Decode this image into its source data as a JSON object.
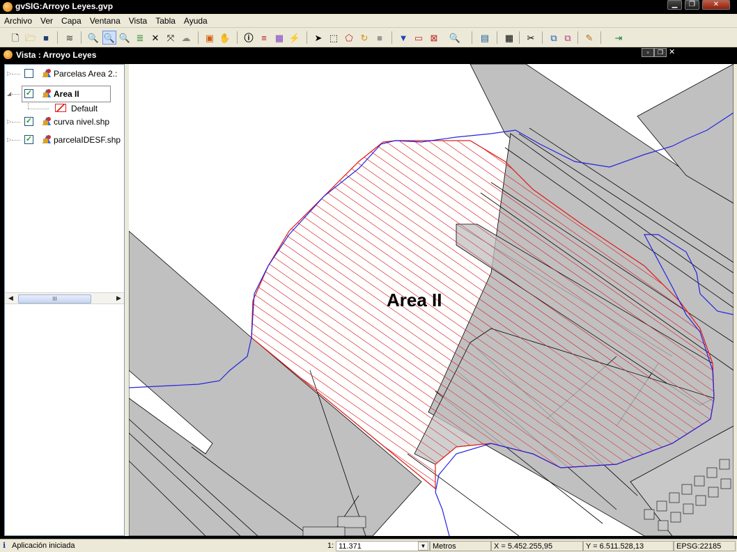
{
  "window": {
    "title": "gvSIG:Arroyo Leyes.gvp"
  },
  "menu": [
    "Archivo",
    "Ver",
    "Capa",
    "Ventana",
    "Vista",
    "Tabla",
    "Ayuda"
  ],
  "toolbar_icons": [
    "new-icon",
    "open-icon",
    "save-icon",
    "add-layer-icon",
    "zoom-all-icon",
    "zoom-in-icon",
    "zoom-out-icon",
    "layers-zoom-icon",
    "zoom-extent-icon",
    "full-extent-icon",
    "zoom-previous-icon",
    "locator-map-icon",
    "pan-icon",
    "info-icon",
    "measure-distance-icon",
    "measure-area-icon",
    "hyperlink-icon",
    "select-icon",
    "select-rect-icon",
    "select-polygon-icon",
    "invert-selection-icon",
    "clear-selection-icon",
    "filter-icon",
    "rect-select-icon",
    "select-layer-icon",
    "zoom-select-icon",
    "attribute-table-icon",
    "grid-icon",
    "tools-icon",
    "copy-icon",
    "paste-icon",
    "edit-icon",
    "export-icon"
  ],
  "view": {
    "title": "Vista : Arroyo Leyes"
  },
  "toc": {
    "layers": [
      {
        "label": "Parcelas Area 2.:",
        "checked": false,
        "bold": false
      },
      {
        "label": "Area II",
        "checked": true,
        "bold": true
      },
      {
        "label": "curva nivel.shp",
        "checked": true,
        "bold": false
      },
      {
        "label": "parcelaIDESF.shp",
        "checked": true,
        "bold": false
      }
    ],
    "legend_label": "Default",
    "scroll_left": "◀",
    "scroll_right": "▶",
    "scroll_thumb": "III"
  },
  "map": {
    "area_label": "Area II"
  },
  "status": {
    "message": "Aplicación iniciada",
    "scale_prefix": "1:",
    "scale_value": "11.371",
    "units": "Metros",
    "x": "X = 5.452.255,95",
    "y": "Y = 6.511.528,13",
    "epsg": "EPSG:22185"
  },
  "colors": {
    "area_hatch": "#e02020",
    "stream": "#2323e0",
    "parcel": "#c0c0c0"
  }
}
